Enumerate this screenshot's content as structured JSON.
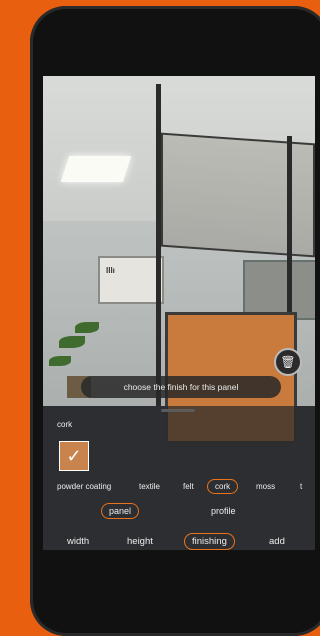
{
  "app": {
    "prompt": "choose the finish for this panel",
    "selected_finish": "cork",
    "swatch_color": "#c8844c",
    "accent_color": "#e8731c",
    "board_text": "lllı"
  },
  "finish_options": [
    "powder coating",
    "textile",
    "felt",
    "cork",
    "moss",
    "t"
  ],
  "sub_tabs": [
    "panel",
    "profile"
  ],
  "main_tabs": [
    "width",
    "height",
    "finishing",
    "add"
  ],
  "icons": {
    "delete": "trash-icon",
    "check": "check-icon"
  }
}
